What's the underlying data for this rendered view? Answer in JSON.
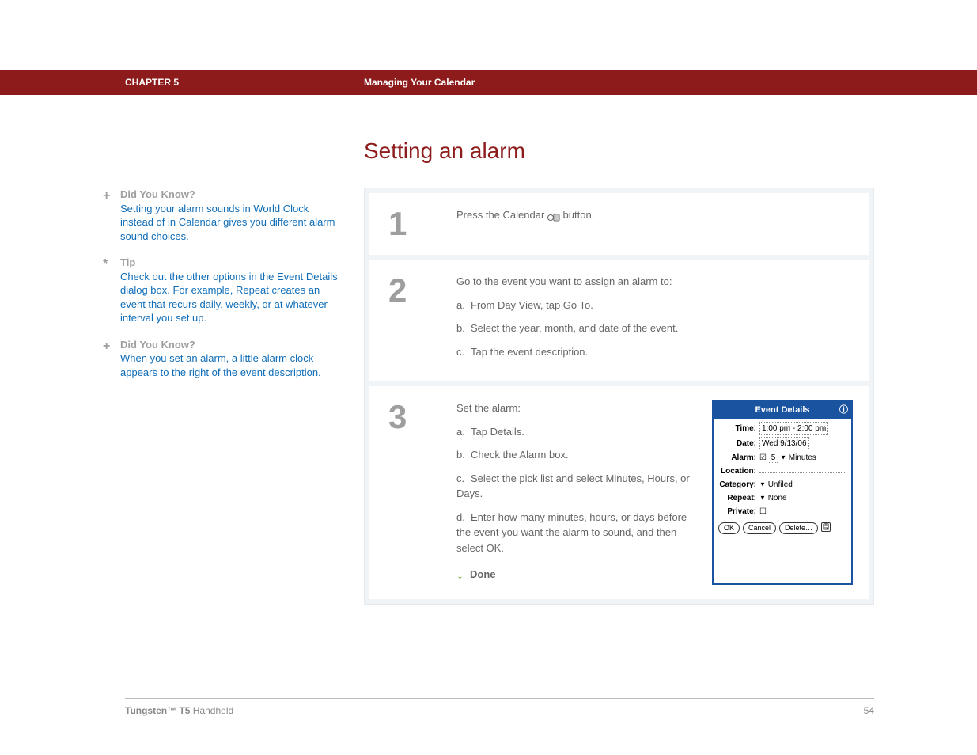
{
  "header": {
    "chapter": "CHAPTER 5",
    "subtitle": "Managing Your Calendar"
  },
  "title": "Setting an alarm",
  "sidebar": [
    {
      "icon": "+",
      "heading": "Did You Know?",
      "body": "Setting your alarm sounds in World Clock instead of in Calendar gives you different alarm sound choices."
    },
    {
      "icon": "*",
      "heading": "Tip",
      "body": "Check out the other options in the Event Details dialog box. For example, Repeat creates an event that recurs daily, weekly, or at whatever interval you set up."
    },
    {
      "icon": "+",
      "heading": "Did You Know?",
      "body": "When you set an alarm, a little alarm clock appears to the right of the event description."
    }
  ],
  "steps": {
    "1": {
      "text_pre": "Press the Calendar ",
      "text_post": " button."
    },
    "2": {
      "intro": "Go to the event you want to assign an alarm to:",
      "items": [
        "From Day View, tap Go To.",
        "Select the year, month, and date of the event.",
        "Tap the event description."
      ]
    },
    "3": {
      "intro": "Set the alarm:",
      "items": [
        "Tap Details.",
        "Check the Alarm box.",
        "Select the pick list and select Minutes, Hours, or Days.",
        "Enter how many minutes, hours, or days before the event you want the alarm to sound, and then select OK."
      ],
      "done": "Done"
    }
  },
  "dialog": {
    "title": "Event Details",
    "time_label": "Time:",
    "time_val": "1:00 pm - 2:00 pm",
    "date_label": "Date:",
    "date_val": "Wed 9/13/06",
    "alarm_label": "Alarm:",
    "alarm_num": "5",
    "alarm_unit": "Minutes",
    "location_label": "Location:",
    "category_label": "Category:",
    "category_val": "Unfiled",
    "repeat_label": "Repeat:",
    "repeat_val": "None",
    "private_label": "Private:",
    "ok": "OK",
    "cancel": "Cancel",
    "delete": "Delete…"
  },
  "footer": {
    "product_bold": "Tungsten™ T5 ",
    "product_rest": "Handheld",
    "page": "54"
  }
}
